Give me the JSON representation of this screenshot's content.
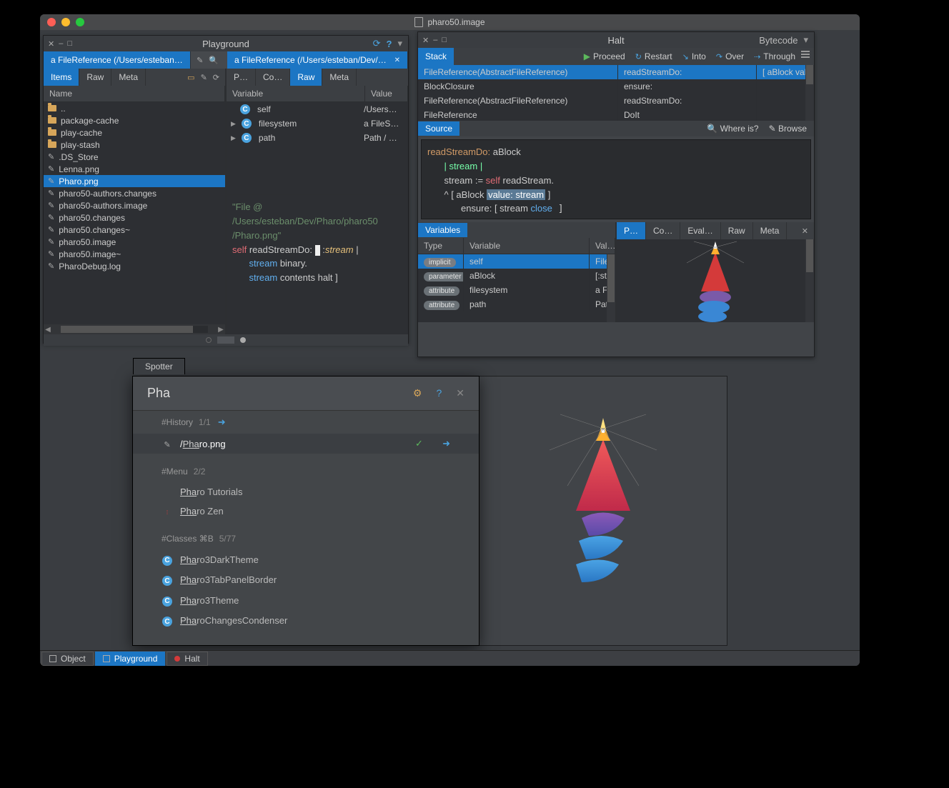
{
  "titlebar": {
    "title": "pharo50.image"
  },
  "playground": {
    "title": "Playground",
    "tabs_left": {
      "label": "a FileReference (/Users/esteban/Dev/Ph…"
    },
    "tabs_right": {
      "label": "a FileReference (/Users/esteban/Dev/Ph…"
    },
    "left_pills": [
      "Items",
      "Raw",
      "Meta"
    ],
    "left_active_pill": "Items",
    "right_pills": [
      "P…",
      "Co…",
      "Raw",
      "Meta"
    ],
    "right_active_pill": "Raw",
    "name_col": "Name",
    "files": [
      {
        "name": "..",
        "type": "folder"
      },
      {
        "name": "package-cache",
        "type": "folder"
      },
      {
        "name": "play-cache",
        "type": "folder"
      },
      {
        "name": "play-stash",
        "type": "folder"
      },
      {
        "name": ".DS_Store",
        "type": "file"
      },
      {
        "name": "Lenna.png",
        "type": "file"
      },
      {
        "name": "Pharo.png",
        "type": "file",
        "selected": true
      },
      {
        "name": "pharo50-authors.changes",
        "type": "file"
      },
      {
        "name": "pharo50-authors.image",
        "type": "file"
      },
      {
        "name": "pharo50.changes",
        "type": "file"
      },
      {
        "name": "pharo50.changes~",
        "type": "file"
      },
      {
        "name": "pharo50.image",
        "type": "file"
      },
      {
        "name": "pharo50.image~",
        "type": "file"
      },
      {
        "name": "PharoDebug.log",
        "type": "file"
      }
    ],
    "var_col": "Variable",
    "val_col": "Value",
    "vars": [
      {
        "name": "self",
        "value": "/Users…",
        "expand": false
      },
      {
        "name": "filesystem",
        "value": "a FileS…",
        "expand": true
      },
      {
        "name": "path",
        "value": "Path / …",
        "expand": true
      }
    ],
    "code": {
      "comment": "\"File @\n/Users/esteban/Dev/Pharo/pharo50\n/Pharo.png\"",
      "l1a": "self",
      "l1b": " readStreamDo: ",
      "l1c": " :",
      "l1d": "stream",
      "l1e": " |",
      "l2a": "stream",
      "l2b": " binary.",
      "l3a": "stream",
      "l3b": " contents halt ]"
    }
  },
  "halt": {
    "title": "Halt",
    "dropdown": "Bytecode",
    "stack_label": "Stack",
    "toolbar": [
      {
        "label": "Proceed",
        "ico": "▶",
        "cls": "green"
      },
      {
        "label": "Restart",
        "ico": "↻",
        "cls": "db-ico"
      },
      {
        "label": "Into",
        "ico": "↘",
        "cls": "db-ico"
      },
      {
        "label": "Over",
        "ico": "↷",
        "cls": "db-ico"
      },
      {
        "label": "Through",
        "ico": "⇢",
        "cls": "db-ico"
      }
    ],
    "stack_rows": [
      {
        "c1": "FileReference(AbstractFileReference)",
        "c2": "readStreamDo:",
        "c3": "[ aBlock valu",
        "sel": true
      },
      {
        "c1": "BlockClosure",
        "c2": "ensure:",
        "c3": ""
      },
      {
        "c1": "FileReference(AbstractFileReference)",
        "c2": "readStreamDo:",
        "c3": ""
      },
      {
        "c1": "FileReference",
        "c2": "DoIt",
        "c3": ""
      }
    ],
    "source_label": "Source",
    "where": "Where is?",
    "browse": "Browse",
    "src": {
      "l1a": "readStreamDo:",
      "l1b": " aBlock",
      "l2": "| stream |",
      "l3a": "stream := ",
      "l3b": "self",
      "l3c": " readStream.",
      "l4a": "^ [ aBlock ",
      "l4hl": "value: stream",
      "l4b": " ]",
      "l5a": "ensure: [ stream ",
      "l5b": "close",
      " l5c": " ]"
    },
    "vars_label": "Variables",
    "var_cols": {
      "c1": "Type",
      "c2": "Variable",
      "c3": "Val…"
    },
    "var_rows": [
      {
        "type": "implicit",
        "name": "self",
        "val": "File",
        "sel": true
      },
      {
        "type": "parameter",
        "name": "aBlock",
        "val": "[:st"
      },
      {
        "type": "attribute",
        "name": "filesystem",
        "val": "a Fi"
      },
      {
        "type": "attribute",
        "name": "path",
        "val": "Patl"
      }
    ],
    "insp_pills": [
      "P…",
      "Co…",
      "Eval…",
      "Raw",
      "Meta"
    ]
  },
  "spotter": {
    "tab": "Spotter",
    "query": "Pha",
    "cats": [
      {
        "title": "#History",
        "count": "1/1",
        "arrow": true,
        "items": [
          {
            "pre": "/",
            "u": "Pha",
            "post": "ro.png",
            "pencil": true,
            "check": true,
            "arrow": true,
            "hl": true
          }
        ]
      },
      {
        "title": "#Menu",
        "count": "2/2",
        "items": [
          {
            "u": "Pha",
            "post": "ro Tutorials"
          },
          {
            "u": "Pha",
            "post": "ro Zen",
            "dots": true
          }
        ]
      },
      {
        "title": "#Classes ⌘B",
        "count": "5/77",
        "items": [
          {
            "u": "Pha",
            "post": "ro3DarkTheme",
            "circ": true
          },
          {
            "u": "Pha",
            "post": "ro3TabPanelBorder",
            "circ": true
          },
          {
            "u": "Pha",
            "post": "ro3Theme",
            "circ": true
          },
          {
            "u": "Pha",
            "post": "roChangesCondenser",
            "circ": true
          }
        ]
      }
    ]
  },
  "taskbar": [
    {
      "label": "Object",
      "ico": "sq"
    },
    {
      "label": "Playground",
      "ico": "sq",
      "active": true
    },
    {
      "label": "Halt",
      "ico": "dot-red"
    }
  ]
}
